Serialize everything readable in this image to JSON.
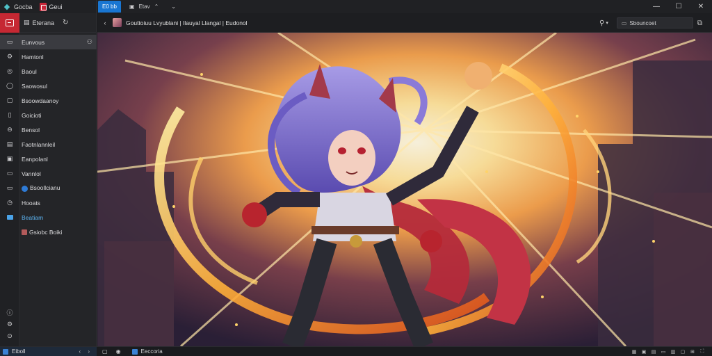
{
  "titlebar": {
    "app_name": "Gocba",
    "app_tab_label": "Geui",
    "tabs": [
      {
        "label": "E0 bb",
        "active": true
      },
      {
        "label": "Etav",
        "active": false
      }
    ],
    "window_controls": {
      "minimize": "—",
      "maximize": "☐",
      "close": "✕"
    }
  },
  "sidebar": {
    "header_title": "Eterana",
    "items": [
      {
        "label": "Eunvous",
        "icon": "folder-icon",
        "selected": true
      },
      {
        "label": "Hamtonl",
        "icon": "gear-icon"
      },
      {
        "label": "Baoul",
        "icon": "globe-icon"
      },
      {
        "label": "Saowosul",
        "icon": "comment-icon"
      },
      {
        "label": "Bsoowdaanoy",
        "icon": "chat-icon"
      },
      {
        "label": "Goicioti",
        "icon": "document-icon"
      },
      {
        "label": "Bensol",
        "icon": "eye-icon"
      },
      {
        "label": "Faotnlannleil",
        "icon": "list-icon"
      },
      {
        "label": "Eanpolanl",
        "icon": "window-icon"
      },
      {
        "label": "Vannlol",
        "icon": "folder-icon"
      },
      {
        "label": "Bsoollcianu",
        "icon": "display-icon"
      },
      {
        "label": "Hooats",
        "icon": "clock-icon"
      },
      {
        "label": "Beatiam",
        "icon": "image-icon",
        "active": true
      },
      {
        "label": "Gsiobc Boiki",
        "icon": "picture-icon"
      }
    ],
    "footer_icons": [
      "info-icon",
      "settings-icon",
      "help-icon"
    ]
  },
  "content_header": {
    "path": "Gouttoiuu Lvyublani | Ilauyal Llangal | Eudonol",
    "search_placeholder": "Sbouncoet"
  },
  "statusbar": {
    "left_label": "Eiboll",
    "left_arrows": "‹ ›",
    "tab_label": "Eeccoria"
  },
  "colors": {
    "accent_blue": "#1976d2",
    "accent_red": "#c62833",
    "bg_dark": "#1b1c1f"
  }
}
